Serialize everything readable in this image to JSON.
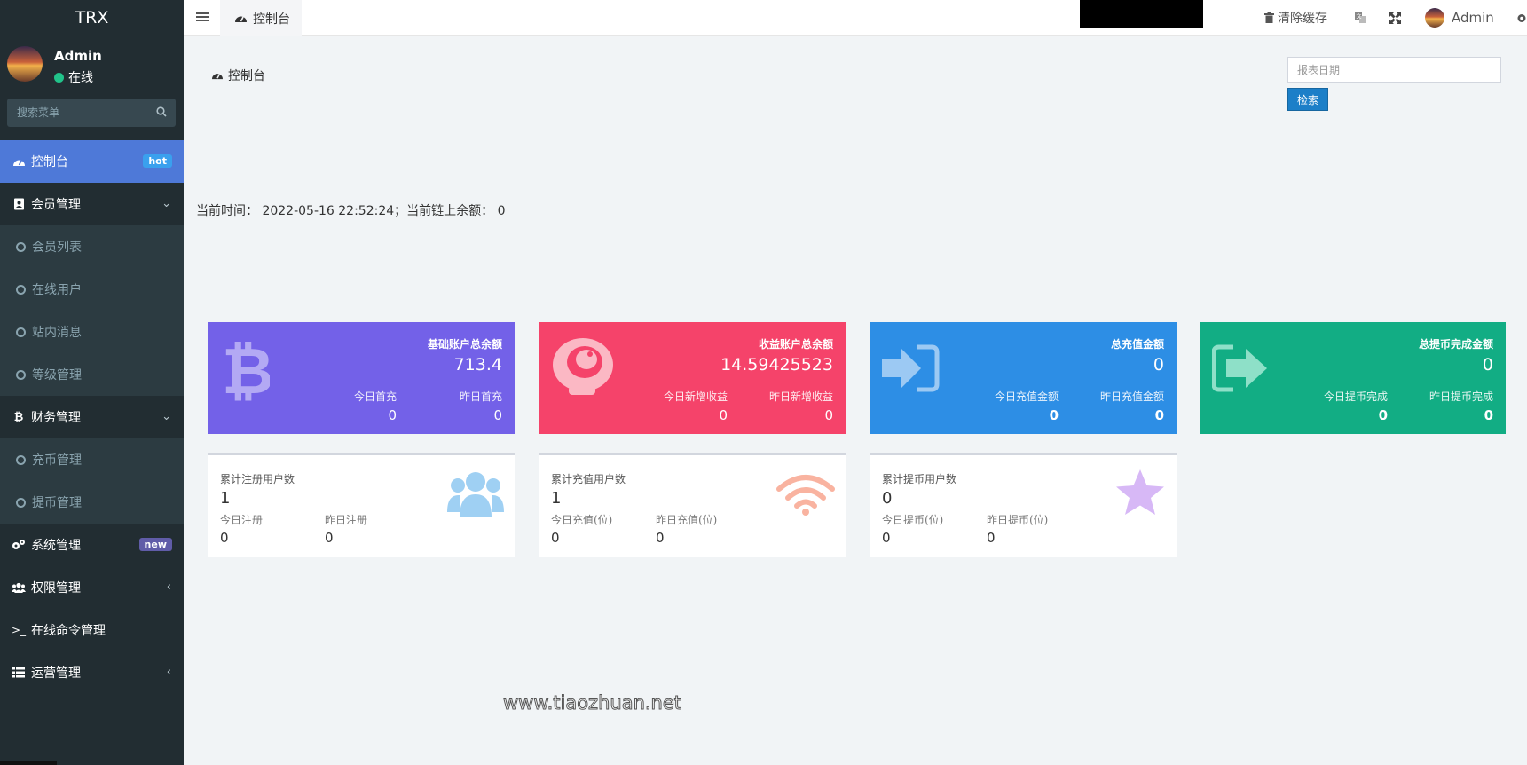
{
  "app": {
    "logo": "TRX"
  },
  "user": {
    "name": "Admin",
    "status": "在线"
  },
  "search": {
    "placeholder": "搜索菜单"
  },
  "menu": {
    "dashboard": {
      "label": "控制台",
      "badge": "hot"
    },
    "members": {
      "label": "会员管理",
      "items": [
        "会员列表",
        "在线用户",
        "站内消息",
        "等级管理"
      ]
    },
    "finance": {
      "label": "财务管理",
      "items": [
        "充币管理",
        "提币管理"
      ]
    },
    "system": {
      "label": "系统管理",
      "badge": "new"
    },
    "permission": {
      "label": "权限管理"
    },
    "command": {
      "label": "在线命令管理"
    },
    "operation": {
      "label": "运营管理"
    }
  },
  "topbar": {
    "tab_label": "控制台",
    "clear_cache": "清除缓存",
    "admin": "Admin"
  },
  "panel": {
    "title": "控制台",
    "date_placeholder": "报表日期",
    "search_button": "检索",
    "current_time_label": "当前时间：",
    "current_time": "2022-05-16 22:52:24",
    "chain_balance_label": "；当前链上余额：",
    "chain_balance": "0"
  },
  "stat_cards": [
    {
      "title": "基础账户总余额",
      "value": "713.4",
      "sub1_label": "今日首充",
      "sub1_value": "0",
      "sub2_label": "昨日首充",
      "sub2_value": "0",
      "color": "#7361e8",
      "icon": "bitcoin-icon"
    },
    {
      "title": "收益账户总余额",
      "value": "14.59425523",
      "sub1_label": "今日新增收益",
      "sub1_value": "0",
      "sub2_label": "昨日新增收益",
      "sub2_value": "0",
      "color": "#f5436a",
      "icon": "dragon-icon"
    },
    {
      "title": "总充值金额",
      "value": "0",
      "sub1_label": "今日充值金额",
      "sub1_value": "0",
      "sub2_label": "昨日充值金额",
      "sub2_value": "0",
      "color": "#2d8ee5",
      "icon": "sign-in-icon"
    },
    {
      "title": "总提币完成金额",
      "value": "0",
      "sub1_label": "今日提币完成",
      "sub1_value": "0",
      "sub2_label": "昨日提币完成",
      "sub2_value": "0",
      "color": "#12ad84",
      "icon": "sign-out-icon"
    }
  ],
  "info_cards": [
    {
      "title": "累计注册用户数",
      "value": "1",
      "sub1_label": "今日注册",
      "sub1_value": "0",
      "sub2_label": "昨日注册",
      "sub2_value": "0",
      "icon": "users-icon"
    },
    {
      "title": "累计充值用户数",
      "value": "1",
      "sub1_label": "今日充值(位)",
      "sub1_value": "0",
      "sub2_label": "昨日充值(位)",
      "sub2_value": "0",
      "icon": "wifi-icon"
    },
    {
      "title": "累计提币用户数",
      "value": "0",
      "sub1_label": "今日提币(位)",
      "sub1_value": "0",
      "sub2_label": "昨日提币(位)",
      "sub2_value": "0",
      "icon": "star-icon"
    }
  ],
  "watermark": "www.tiaozhuan.net"
}
